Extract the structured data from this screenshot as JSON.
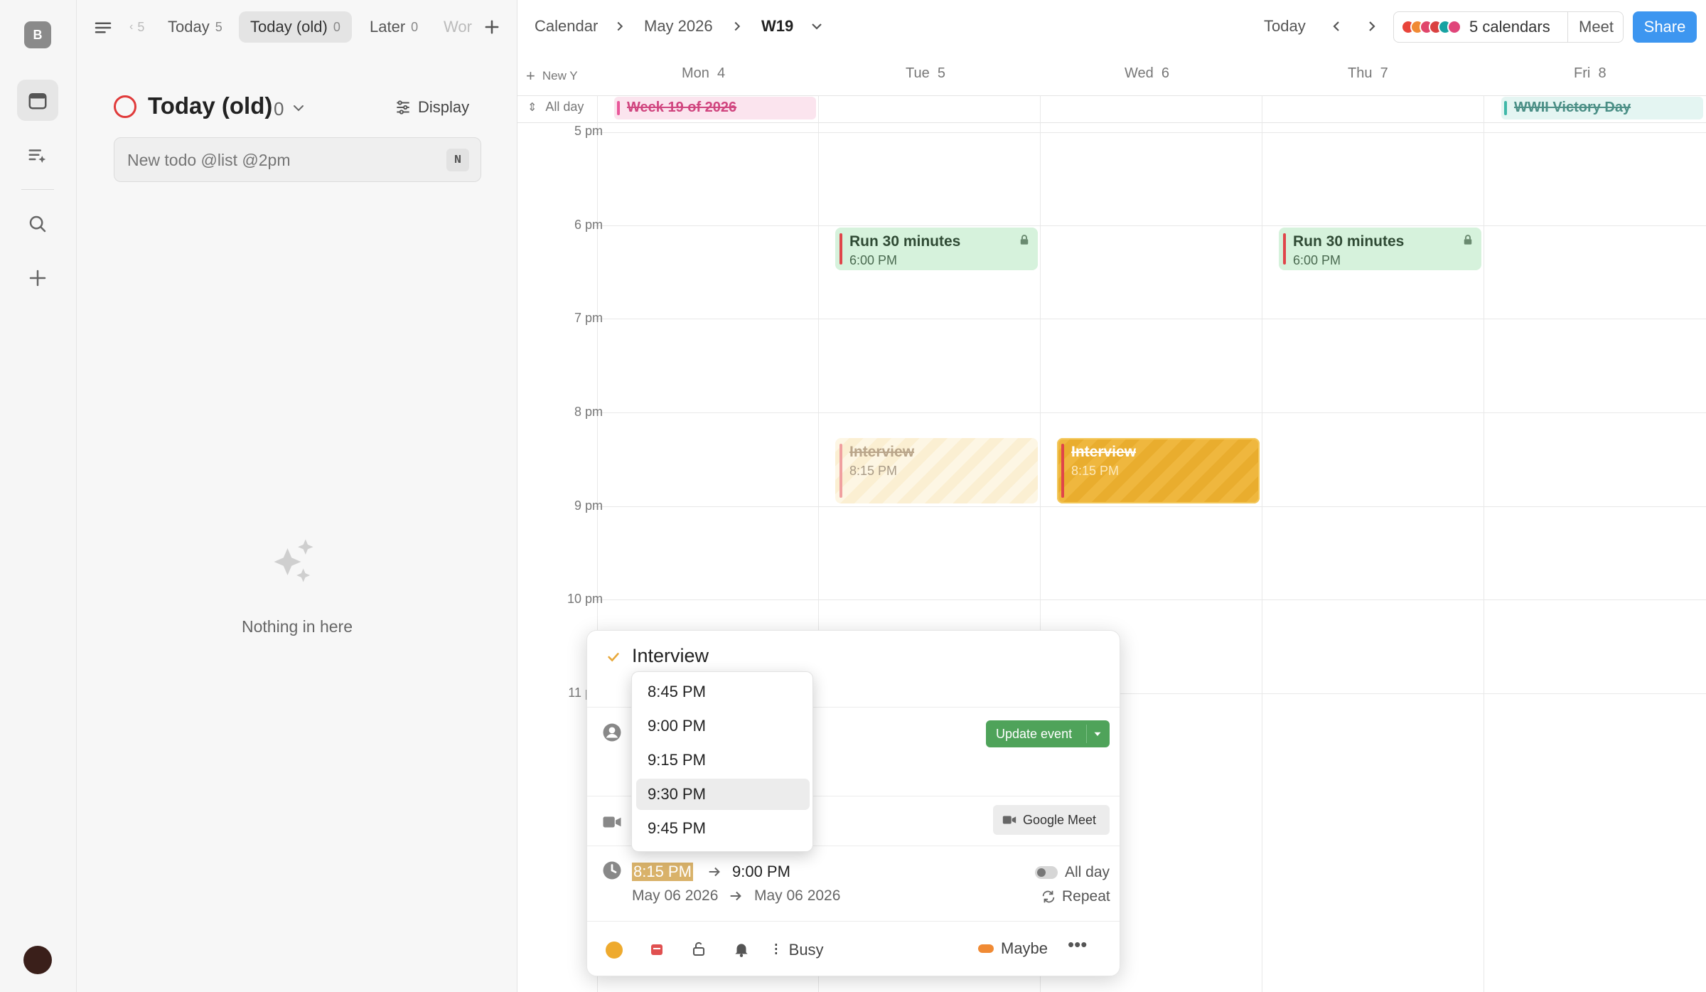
{
  "workspace": {
    "initial": "B"
  },
  "left": {
    "tabs": [
      {
        "label": "5",
        "count": ""
      },
      {
        "label": "Today",
        "count": "5"
      },
      {
        "label": "Today (old)",
        "count": "0"
      },
      {
        "label": "Later",
        "count": "0"
      },
      {
        "label": "Wor",
        "count": ""
      }
    ],
    "list_title": "Today (old)",
    "list_count": "0",
    "display_label": "Display",
    "new_todo_placeholder": "New todo @list @2pm",
    "shortcut": "N",
    "empty_text": "Nothing in here"
  },
  "header": {
    "crumb1": "Calendar",
    "crumb2": "May 2026",
    "crumb3": "W19",
    "today": "Today",
    "calendars": "5 calendars",
    "meet": "Meet",
    "share": "Share",
    "cal_colors": [
      "#e8443a",
      "#f08a34",
      "#e0456a",
      "#d94040",
      "#17a2a2",
      "#e0457a"
    ]
  },
  "grid": {
    "new_label": "New Y",
    "allday_label": "All day",
    "days": [
      {
        "name": "Mon",
        "num": "4"
      },
      {
        "name": "Tue",
        "num": "5"
      },
      {
        "name": "Wed",
        "num": "6"
      },
      {
        "name": "Thu",
        "num": "7"
      },
      {
        "name": "Fri",
        "num": "8"
      }
    ],
    "hours": [
      "5 pm",
      "6 pm",
      "7 pm",
      "8 pm",
      "9 pm",
      "10 pm",
      "11 pm"
    ],
    "allday_events": [
      {
        "title": "Week 19 of 2026",
        "color": "#e9579a"
      },
      {
        "title": "WWII Victory Day",
        "color": "#3fb8a8"
      }
    ],
    "events": [
      {
        "title": "Run 30 minutes",
        "time": "6:00 PM"
      },
      {
        "title": "Run 30 minutes",
        "time": "6:00 PM"
      },
      {
        "title": "Interview",
        "time": "8:15 PM"
      },
      {
        "title": "Interview",
        "time": "8:15 PM"
      }
    ]
  },
  "popup": {
    "title": "Interview",
    "update_btn": "Update event",
    "google_meet": "Google Meet",
    "start_time": "8:15 PM",
    "end_time": "9:00 PM",
    "start_date": "May 06 2026",
    "end_date": "May 06 2026",
    "all_day": "All day",
    "repeat": "Repeat",
    "busy": "Busy",
    "maybe": "Maybe"
  },
  "time_options": [
    "8:45 PM",
    "9:00 PM",
    "9:15 PM",
    "9:30 PM",
    "9:45 PM"
  ],
  "selected_option": "9:30 PM"
}
